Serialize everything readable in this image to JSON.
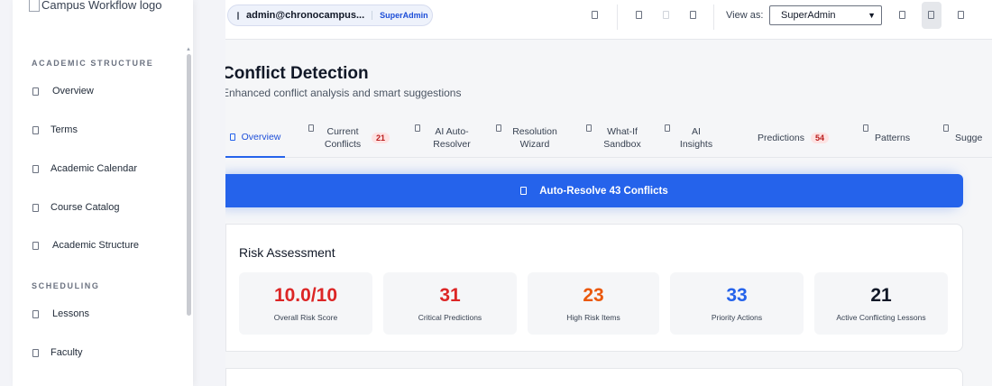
{
  "sidebar": {
    "logo_alt": "Campus Workflow logo",
    "sections": [
      {
        "title": "ACADEMIC STRUCTURE"
      },
      {
        "title": "SCHEDULING"
      }
    ],
    "items": [
      {
        "label": "Overview",
        "icon": "home-icon"
      },
      {
        "label": "Terms",
        "icon": "calendar-icon"
      },
      {
        "label": "Academic Calendar",
        "icon": "calendar-icon"
      },
      {
        "label": "Course Catalog",
        "icon": "book-icon"
      },
      {
        "label": "Academic Structure",
        "icon": "building-icon"
      },
      {
        "label": "Lessons",
        "icon": "clipboard-icon"
      },
      {
        "label": "Faculty",
        "icon": "user-icon"
      }
    ]
  },
  "topbar": {
    "user_email": "admin@chronocampus...",
    "user_role": "SuperAdmin",
    "view_as_label": "View as:",
    "view_as_value": "SuperAdmin"
  },
  "page": {
    "title": "Conflict Detection",
    "subtitle": "Enhanced conflict analysis and smart suggestions"
  },
  "tabs": [
    {
      "label": "Overview",
      "active": true
    },
    {
      "label": "Current Conflicts",
      "badge": "21"
    },
    {
      "label": "AI Auto-Resolver"
    },
    {
      "label": "Resolution Wizard"
    },
    {
      "label": "What-If Sandbox"
    },
    {
      "label": "AI Insights"
    },
    {
      "label": "Predictions",
      "badge": "54"
    },
    {
      "label": "Patterns"
    },
    {
      "label": "Sugge"
    }
  ],
  "resolve_button": {
    "label": "Auto-Resolve 43 Conflicts"
  },
  "risk": {
    "title": "Risk Assessment",
    "metrics": [
      {
        "value": "10.0/10",
        "label": "Overall Risk Score",
        "color": "#dc2626"
      },
      {
        "value": "31",
        "label": "Critical Predictions",
        "color": "#dc2626"
      },
      {
        "value": "23",
        "label": "High Risk Items",
        "color": "#ea580c"
      },
      {
        "value": "33",
        "label": "Priority Actions",
        "color": "#2563eb"
      },
      {
        "value": "21",
        "label": "Active Conflicting Lessons",
        "color": "#111827"
      }
    ]
  }
}
